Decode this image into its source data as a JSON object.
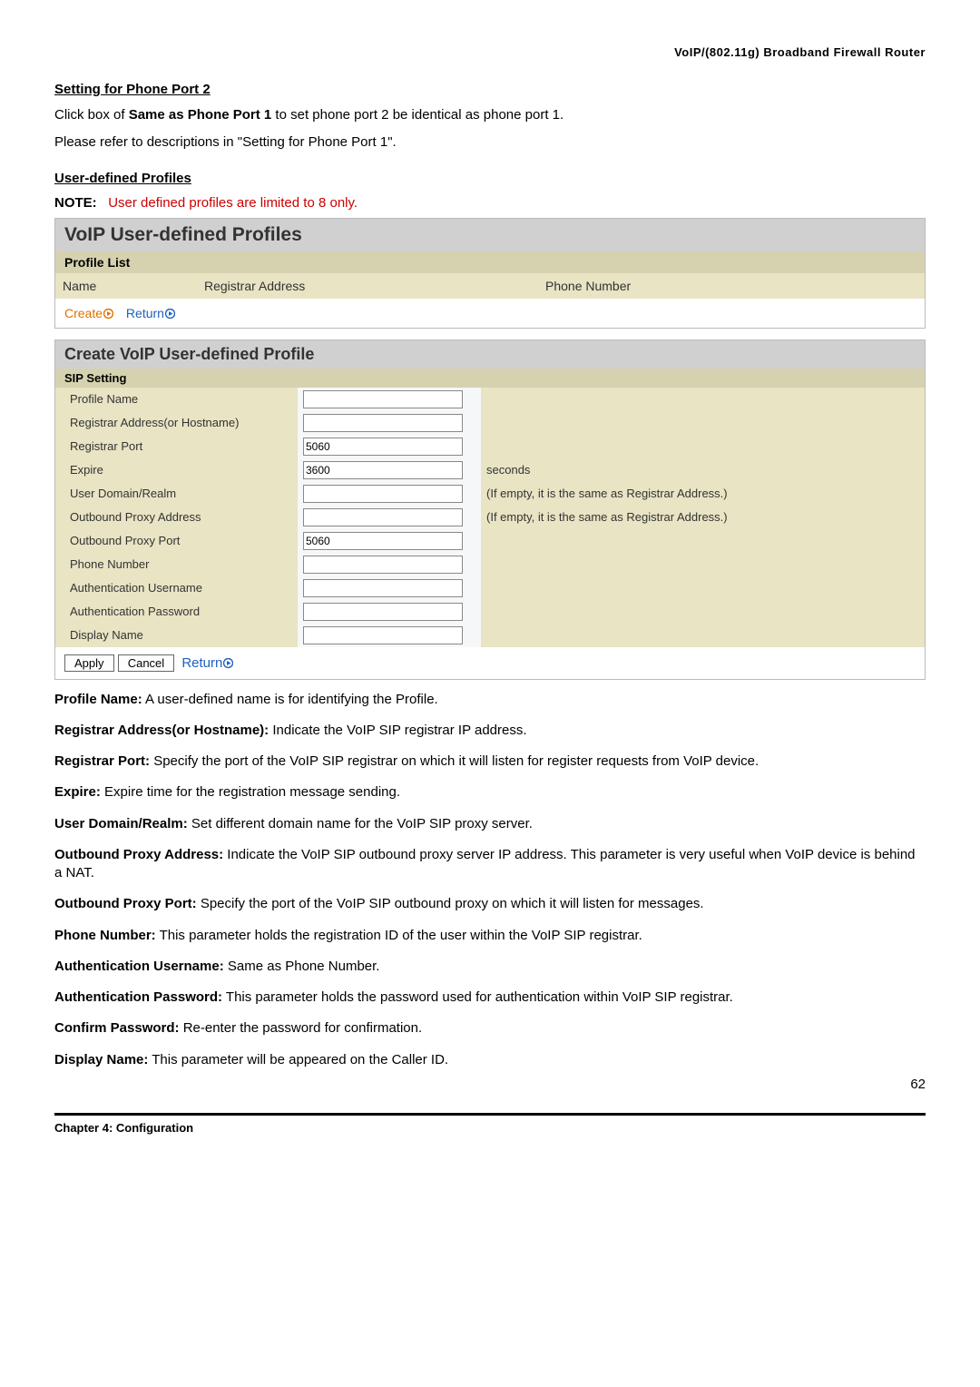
{
  "header_right": "VoIP/(802.11g)  Broadband  Firewall  Router",
  "phone_port2": {
    "heading": "Setting for Phone Port 2",
    "line1_pre": "Click box of ",
    "line1_bold": "Same as Phone Port 1",
    "line1_post": " to set phone port 2 be identical as phone port 1.",
    "line2": "Please refer to descriptions in \"Setting for Phone Port 1\"."
  },
  "udp": {
    "heading": "User-defined Profiles",
    "note_label": "NOTE:",
    "note_text": "User defined profiles are limited to 8 only."
  },
  "panel1": {
    "title": "VoIP User-defined Profiles",
    "subtitle": "Profile List",
    "col_name": "Name",
    "col_addr": "Registrar Address",
    "col_phone": "Phone Number",
    "link_create": "Create",
    "link_return": "Return"
  },
  "panel2": {
    "title": "Create VoIP User-defined Profile",
    "subtitle": "SIP Setting",
    "rows": [
      {
        "label": "Profile Name",
        "value": "",
        "hint": ""
      },
      {
        "label": "Registrar Address(or Hostname)",
        "value": "",
        "hint": ""
      },
      {
        "label": "Registrar Port",
        "value": "5060",
        "hint": ""
      },
      {
        "label": "Expire",
        "value": "3600",
        "hint": "seconds"
      },
      {
        "label": "User Domain/Realm",
        "value": "",
        "hint": "(If empty, it is the same as Registrar Address.)"
      },
      {
        "label": "Outbound Proxy Address",
        "value": "",
        "hint": "(If empty, it is the same as Registrar Address.)"
      },
      {
        "label": "Outbound Proxy Port",
        "value": "5060",
        "hint": ""
      },
      {
        "label": "Phone Number",
        "value": "",
        "hint": ""
      },
      {
        "label": "Authentication Username",
        "value": "",
        "hint": ""
      },
      {
        "label": "Authentication Password",
        "value": "",
        "hint": ""
      },
      {
        "label": "Display Name",
        "value": "",
        "hint": ""
      }
    ],
    "btn_apply": "Apply",
    "btn_cancel": "Cancel",
    "btn_return": "Return"
  },
  "descriptions": [
    {
      "label": "Profile Name:",
      "text": " A user-defined name is for identifying the Profile."
    },
    {
      "label": "Registrar Address(or Hostname):",
      "text": " Indicate the VoIP SIP registrar IP address."
    },
    {
      "label": "Registrar Port:",
      "text": " Specify the port of the VoIP SIP registrar on which it will listen for register requests from VoIP device."
    },
    {
      "label": "Expire:",
      "text": " Expire time for the registration message sending."
    },
    {
      "label": "User Domain/Realm:",
      "text": " Set different domain name for the VoIP SIP proxy server."
    },
    {
      "label": "Outbound Proxy Address:",
      "text": " Indicate the VoIP SIP outbound proxy server IP address. This parameter is very useful when VoIP device is behind a NAT."
    },
    {
      "label": "Outbound Proxy Port:",
      "text": " Specify the port of the VoIP SIP outbound proxy on which it will listen for messages."
    },
    {
      "label": "Phone Number:",
      "text": " This parameter holds the registration ID of the user within the VoIP SIP registrar."
    },
    {
      "label": "Authentication Username:",
      "text": " Same as Phone Number."
    },
    {
      "label": "Authentication Password:",
      "text": " This parameter holds the password used for authentication within VoIP SIP registrar."
    },
    {
      "label": "Confirm Password:",
      "text": " Re-enter the password for confirmation."
    },
    {
      "label": "Display Name:",
      "text": " This parameter will be appeared on the Caller ID."
    }
  ],
  "page_number": "62",
  "footer_left": "Chapter 4: Configuration"
}
